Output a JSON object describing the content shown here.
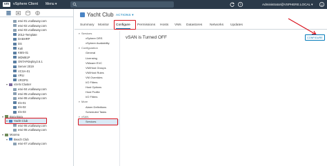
{
  "header": {
    "logo": "vm",
    "app_title": "vSphere Client",
    "menu_label": "Menu ▾",
    "user": "Administrator@VSPHERE.LOCAL ▾"
  },
  "navigator": {
    "items": [
      {
        "label": "esxi-01.vcallaway.com",
        "indent": 2,
        "icon": "host"
      },
      {
        "label": "esxi-02.vcallaway.com",
        "indent": 2,
        "icon": "host"
      },
      {
        "label": "esxi-03.vcallaway.com",
        "indent": 2,
        "icon": "host"
      },
      {
        "label": "2012-Template",
        "indent": 2,
        "icon": "vm"
      },
      {
        "label": "DABHRP",
        "indent": 2,
        "icon": "vm"
      },
      {
        "label": "DS",
        "indent": 2,
        "icon": "vm"
      },
      {
        "label": "Kali",
        "indent": 2,
        "icon": "vm"
      },
      {
        "label": "KMS-01",
        "indent": 2,
        "icon": "vm"
      },
      {
        "label": "MDM81P",
        "indent": 2,
        "icon": "vm"
      },
      {
        "label": "ONTAPdeploy2.6.1",
        "indent": 2,
        "icon": "vm"
      },
      {
        "label": "Server 2019",
        "indent": 2,
        "icon": "vm"
      },
      {
        "label": "VCSA-01",
        "indent": 2,
        "icon": "vm"
      },
      {
        "label": "VRLI",
        "indent": 2,
        "icon": "vm"
      },
      {
        "label": "VROPS",
        "indent": 2,
        "icon": "vm"
      },
      {
        "label": "vSAN Cluster",
        "indent": 1,
        "icon": "cluster",
        "chevron": "▾"
      },
      {
        "label": "esxi-04.vcallaway.com",
        "indent": 2,
        "icon": "host"
      },
      {
        "label": "esxi-05.vcallaway.com",
        "indent": 2,
        "icon": "host"
      },
      {
        "label": "esxi-06.vcallaway.com",
        "indent": 2,
        "icon": "host"
      },
      {
        "label": "Iris-01",
        "indent": 2,
        "icon": "vm"
      },
      {
        "label": "Iris-02",
        "indent": 2,
        "icon": "vm"
      },
      {
        "label": "Iris-03",
        "indent": 2,
        "icon": "vm"
      },
      {
        "label": "Bora Bora",
        "indent": 0,
        "icon": "dc",
        "chevron": "▾"
      },
      {
        "label": "Yacht Club",
        "indent": 1,
        "icon": "club",
        "chevron": "▾",
        "selected": true
      },
      {
        "label": "esxi-06.vcallaway.com",
        "indent": 2,
        "icon": "host"
      },
      {
        "label": "esxi-06.vcallaway.com",
        "indent": 2,
        "icon": "host"
      },
      {
        "label": "Moorea",
        "indent": 0,
        "icon": "dc",
        "chevron": "▾"
      },
      {
        "label": "Beach Club",
        "indent": 1,
        "icon": "club",
        "chevron": "▾"
      },
      {
        "label": "esxi-07.vcallaway.com",
        "indent": 2,
        "icon": "host"
      }
    ]
  },
  "object": {
    "title": "Yacht Club",
    "actions_label": "ACTIONS ▾"
  },
  "tabs": [
    {
      "label": "Summary",
      "active": false
    },
    {
      "label": "Monitor",
      "active": false
    },
    {
      "label": "Configure",
      "active": true
    },
    {
      "label": "Permissions",
      "active": false
    },
    {
      "label": "Hosts",
      "active": false
    },
    {
      "label": "VMs",
      "active": false
    },
    {
      "label": "Datastores",
      "active": false
    },
    {
      "label": "Networks",
      "active": false
    },
    {
      "label": "Updates",
      "active": false
    }
  ],
  "config_menu": [
    {
      "label": "Services",
      "type": "group"
    },
    {
      "label": "vSphere DRS",
      "type": "item"
    },
    {
      "label": "vSphere Availability",
      "type": "item"
    },
    {
      "label": "Configuration",
      "type": "group"
    },
    {
      "label": "General",
      "type": "item"
    },
    {
      "label": "Licensing",
      "type": "item"
    },
    {
      "label": "VMware EVC",
      "type": "item"
    },
    {
      "label": "VM/Host Groups",
      "type": "item"
    },
    {
      "label": "VM/Host Rules",
      "type": "item"
    },
    {
      "label": "VM Overrides",
      "type": "item"
    },
    {
      "label": "I/O Filters",
      "type": "item"
    },
    {
      "label": "Host Options",
      "type": "item"
    },
    {
      "label": "Host Profile",
      "type": "item"
    },
    {
      "label": "I/O Filters",
      "type": "item"
    },
    {
      "label": "More",
      "type": "group"
    },
    {
      "label": "Alarm Definitions",
      "type": "item"
    },
    {
      "label": "Scheduled Tasks",
      "type": "item"
    },
    {
      "label": "vSAN",
      "type": "group"
    },
    {
      "label": "Services",
      "type": "item",
      "selected": true
    }
  ],
  "content": {
    "title": "vSAN is Turned OFF",
    "configure_button": "CONFIGURE"
  },
  "colors": {
    "header_bg": "#2b3a4a",
    "accent": "#0079b8",
    "highlight_box": "#d9121c",
    "selection_bg": "#dbe9f5"
  }
}
